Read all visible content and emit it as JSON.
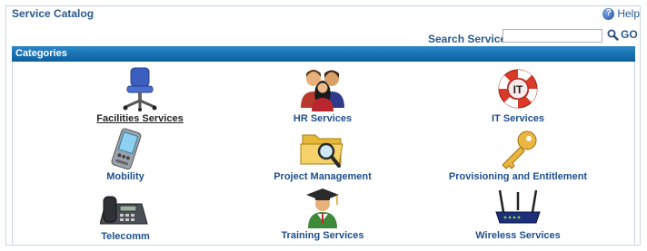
{
  "app": {
    "title": "Service Catalog",
    "help_label": "Help"
  },
  "search": {
    "label": "Search Services",
    "value": "",
    "placeholder": "",
    "go_label": "GO"
  },
  "categories_header": "Categories",
  "categories": [
    {
      "label": "Facilities Services",
      "icon": "office-chair-icon"
    },
    {
      "label": "HR Services",
      "icon": "people-icon"
    },
    {
      "label": "IT Services",
      "icon": "lifebuoy-icon"
    },
    {
      "label": "Mobility",
      "icon": "pda-icon"
    },
    {
      "label": "Project Management",
      "icon": "folder-search-icon"
    },
    {
      "label": "Provisioning and Entitlement",
      "icon": "key-icon"
    },
    {
      "label": "Telecomm",
      "icon": "desk-phone-icon"
    },
    {
      "label": "Training Services",
      "icon": "graduate-icon"
    },
    {
      "label": "Wireless Services",
      "icon": "router-icon"
    }
  ],
  "colors": {
    "accent": "#2a5a8c",
    "header_bar": "#1a73b5"
  }
}
